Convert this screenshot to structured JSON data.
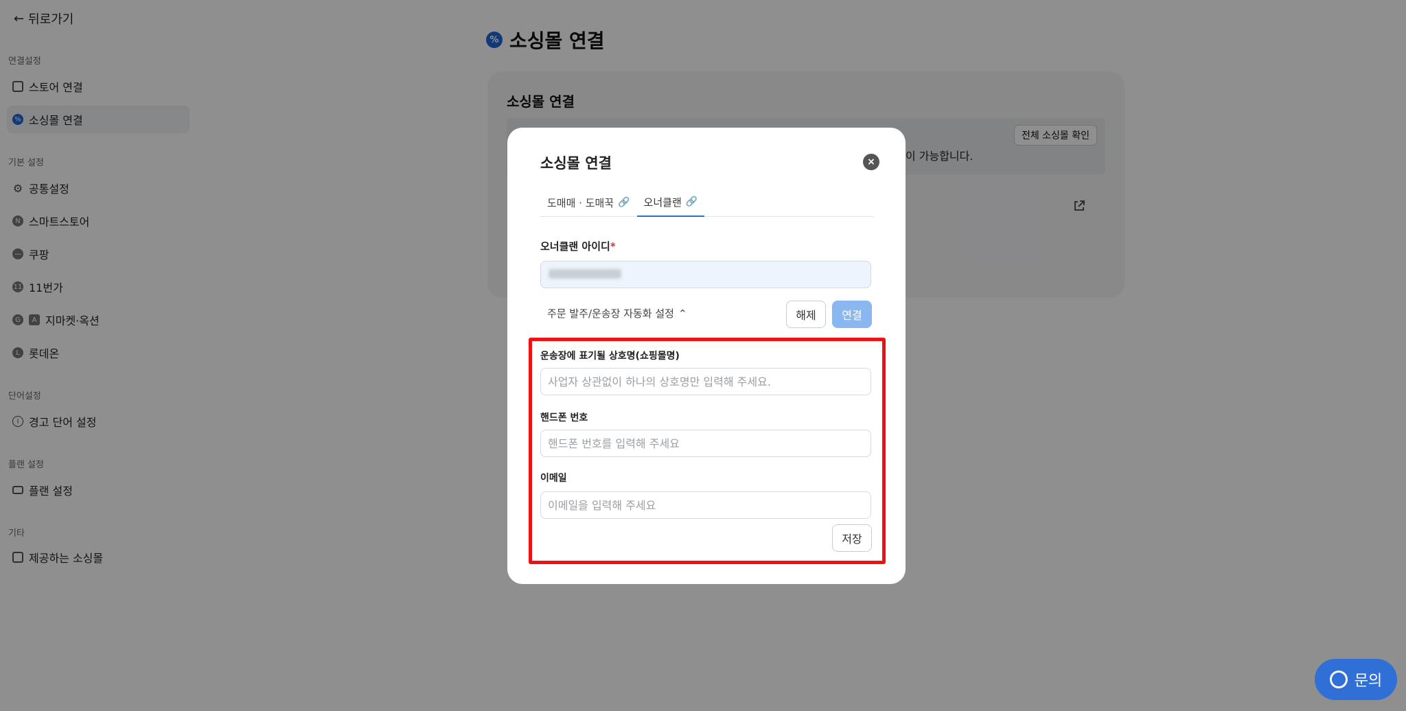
{
  "sidebar": {
    "back_label": "뒤로가기",
    "sections": [
      {
        "title": "연결설정",
        "items": [
          {
            "label": "스토어 연결"
          },
          {
            "label": "소싱몰 연결"
          }
        ]
      },
      {
        "title": "기본 설정",
        "items": [
          {
            "label": "공통설정"
          },
          {
            "label": "스마트스토어"
          },
          {
            "label": "쿠팡"
          },
          {
            "label": "11번가"
          },
          {
            "label": "지마켓·옥션"
          },
          {
            "label": "롯데온"
          }
        ]
      },
      {
        "title": "단어설정",
        "items": [
          {
            "label": "경고 단어 설정"
          }
        ]
      },
      {
        "title": "플랜 설정",
        "items": [
          {
            "label": "플랜 설정"
          }
        ]
      },
      {
        "title": "기타",
        "items": [
          {
            "label": "제공하는 소싱몰"
          }
        ]
      }
    ]
  },
  "main": {
    "title": "소싱몰 연결",
    "card_title": "소싱몰 연결",
    "notice_text": "핑)이 가능합니다.",
    "all_button": "전체 소싱몰 확인"
  },
  "modal": {
    "title": "소싱몰 연결",
    "tabs": [
      {
        "label": "도매매 · 도매꾹"
      },
      {
        "label": "오너클랜"
      }
    ],
    "id_label": "오너클랜 아이디",
    "required_mark": "*",
    "auto_toggle": "주문 발주/운송장 자동화 설정",
    "release_button": "해제",
    "connect_button": "연결",
    "store_name_label": "운송장에 표기될 상호명(쇼핑몰명)",
    "store_name_placeholder": "사업자 상관없이 하나의 상호명만 입력해 주세요.",
    "phone_label": "핸드폰 번호",
    "phone_placeholder": "핸드폰 번호를 입력해 주세요",
    "email_label": "이메일",
    "email_placeholder": "이메일을 입력해 주세요",
    "save_button": "저장"
  },
  "fab": {
    "label": "문의"
  },
  "colors": {
    "accent": "#2f6fd6",
    "highlight": "#e11111",
    "connect_disabled": "#8ab7f0"
  }
}
